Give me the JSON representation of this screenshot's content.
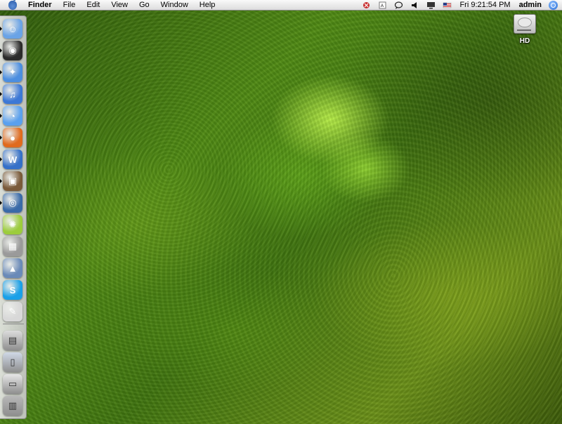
{
  "menubar": {
    "app_name": "Finder",
    "items": [
      "File",
      "Edit",
      "View",
      "Go",
      "Window",
      "Help"
    ],
    "clock": "Fri 9:21:54 PM",
    "user": "admin",
    "status_icons": [
      "bluetooth-icon",
      "text-input-icon",
      "speech-bubble-icon",
      "volume-icon",
      "display-icon",
      "flag-icon"
    ]
  },
  "desktop": {
    "hd_label": "HD"
  },
  "dock": {
    "apps": [
      {
        "name": "finder-icon",
        "color": "#6aa3e6",
        "glyph": "☺"
      },
      {
        "name": "dashboard-icon",
        "color": "#2b2b2b",
        "glyph": "◉"
      },
      {
        "name": "safari-icon",
        "color": "#4c8ee0",
        "glyph": "✦"
      },
      {
        "name": "itunes-icon",
        "color": "#3c78d6",
        "glyph": "♫"
      },
      {
        "name": "ichat-icon",
        "color": "#5aa0ee",
        "glyph": "◔"
      },
      {
        "name": "firefox-icon",
        "color": "#e06a1e",
        "glyph": "●"
      },
      {
        "name": "word-icon",
        "color": "#3570c8",
        "glyph": "W"
      },
      {
        "name": "preview-icon",
        "color": "#7a5a3a",
        "glyph": "▣"
      },
      {
        "name": "quicktime-icon",
        "color": "#3a6aa8",
        "glyph": "◎"
      },
      {
        "name": "limewire-icon",
        "color": "#9ccc3c",
        "glyph": "✺"
      },
      {
        "name": "calculator-icon",
        "color": "#9a9a9a",
        "glyph": "▦"
      },
      {
        "name": "network-icon",
        "color": "#6a8ab8",
        "glyph": "▲"
      },
      {
        "name": "skype-icon",
        "color": "#1aa0e8",
        "glyph": "S"
      },
      {
        "name": "textedit-icon",
        "color": "#d8d8d8",
        "glyph": "✎"
      }
    ],
    "docs": [
      {
        "name": "window-minimized-icon",
        "color": "#dcdcdc",
        "glyph": "▤"
      },
      {
        "name": "applications-folder-icon",
        "color": "#cfd8e6",
        "glyph": "▯"
      },
      {
        "name": "browser-window-icon",
        "color": "#e6e6e6",
        "glyph": "▭"
      },
      {
        "name": "trash-icon",
        "color": "#b8b8b8",
        "glyph": "▥"
      }
    ]
  }
}
